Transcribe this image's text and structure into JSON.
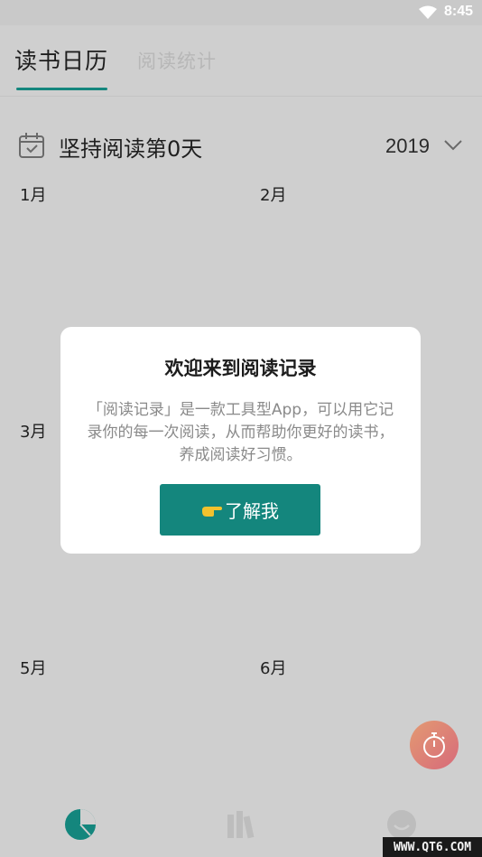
{
  "status_bar": {
    "time": "8:45",
    "wifi_icon": "wifi-icon"
  },
  "tabs": [
    {
      "label": "读书日历",
      "active": true
    },
    {
      "label": "阅读统计",
      "active": false
    }
  ],
  "streak": {
    "icon": "calendar-check-icon",
    "text": "坚持阅读第0天"
  },
  "year_selector": {
    "value": "2019",
    "icon": "chevron-down-icon"
  },
  "months": [
    "1月",
    "2月",
    "3月",
    "5月",
    "6月"
  ],
  "dialog": {
    "title": "欢迎来到阅读记录",
    "body": "「阅读记录」是一款工具型App，可以用它记录你的每一次阅读，从而帮助你更好的读书，养成阅读好习惯。",
    "button_label": "了解我",
    "button_icon": "pointing-hand-icon"
  },
  "fab": {
    "icon": "stopwatch-icon"
  },
  "bottom_nav": [
    {
      "icon": "pie-chart-icon",
      "active": true
    },
    {
      "icon": "bookshelf-icon",
      "active": false
    },
    {
      "icon": "profile-icon",
      "active": false
    }
  ],
  "watermark": "WWW.QT6.COM",
  "colors": {
    "accent": "#14867d",
    "fab_gradient_start": "#e39a72",
    "fab_gradient_end": "#d76a7a"
  }
}
